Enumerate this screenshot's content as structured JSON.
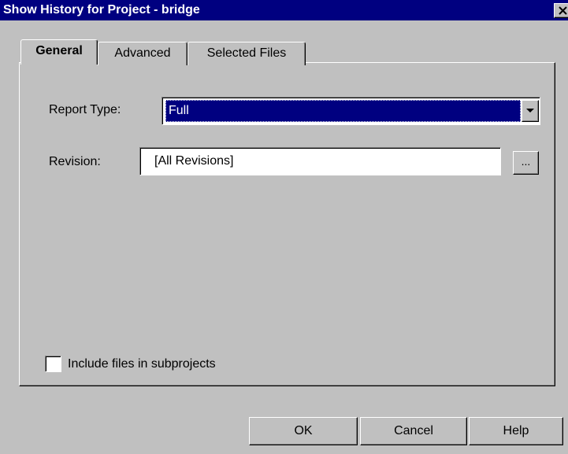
{
  "window": {
    "title": "Show History for Project - bridge"
  },
  "tabs": [
    {
      "label": "General",
      "active": true
    },
    {
      "label": "Advanced",
      "active": false
    },
    {
      "label": "Selected Files",
      "active": false
    }
  ],
  "general": {
    "report_type_label": "Report Type:",
    "report_type_value": "Full",
    "revision_label": "Revision:",
    "revision_value": "[All Revisions]",
    "browse_label": "...",
    "include_subprojects_label": "Include files in subprojects",
    "include_subprojects_checked": false
  },
  "buttons": {
    "ok": "OK",
    "cancel": "Cancel",
    "help": "Help"
  },
  "icons": {
    "close": "close-icon",
    "dropdown": "chevron-down-icon"
  },
  "colors": {
    "titlebar": "#000080",
    "face": "#c0c0c0",
    "selection": "#000080"
  }
}
